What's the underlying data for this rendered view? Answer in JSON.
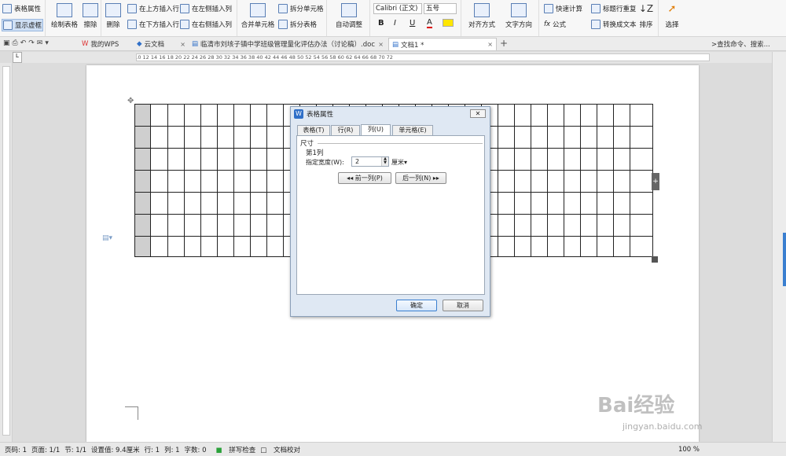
{
  "ribbon": {
    "table_props": "表格属性",
    "show_gridlines": "显示虚框",
    "draw_table": "绘制表格",
    "erase": "擦除",
    "delete": "删除",
    "insert_row_above": "在上方插入行",
    "insert_row_below": "在下方插入行",
    "insert_col_left": "在左侧插入列",
    "insert_col_right": "在右侧插入列",
    "merge_cells": "合并单元格",
    "split_cells": "拆分单元格",
    "split_table": "拆分表格",
    "auto_fit": "自动调整",
    "font_name": "Calibri (正文)",
    "font_size": "五号",
    "bold": "B",
    "italic": "I",
    "underline": "U",
    "font_color": "A",
    "align": "对齐方式",
    "text_direction": "文字方向",
    "quick_calc": "快速计算",
    "formula": "公式",
    "repeat_header": "标题行重复",
    "to_text": "转换成文本",
    "sort": "排序",
    "select": "选择"
  },
  "quickbar": {
    "search": ">查找命令、搜索..."
  },
  "tabs": [
    {
      "label": "我的WPS"
    },
    {
      "label": "云文档"
    },
    {
      "label": "临清市刘垓子镇中学班级管理量化评估办法（讨论稿）.doc"
    },
    {
      "label": "文档1 *"
    }
  ],
  "ruler_marks": "4  2     2  4  6  8  10  12  14  16  18  20  22  24  26  28  30  32  34  36  38  40  42  44  46  48  50  52  54  56  58  60  62  64  66  68  70  72",
  "dialog": {
    "title": "表格属性",
    "tabs": [
      "表格(T)",
      "行(R)",
      "列(U)",
      "单元格(E)"
    ],
    "section": "尺寸",
    "column_label": "第1列",
    "width_label": "指定宽度(W):",
    "width_value": "2",
    "unit": "厘米",
    "prev_col": "◂◂ 前一列(P)",
    "next_col": "后一列(N) ▸▸",
    "ok": "确定",
    "cancel": "取消"
  },
  "status": {
    "page": "页码: 1",
    "pages": "页面: 1/1",
    "section": "节: 1/1",
    "setting": "设置值: 9.4厘米",
    "row": "行: 1",
    "col": "列: 1",
    "words": "字数: 0",
    "spell": "拼写检查",
    "proof": "文档校对",
    "zoom": "100 %"
  },
  "watermark": {
    "text": "Bai经验",
    "url": "jingyan.baidu.com"
  },
  "colors": {
    "accent": "#3a7fd0",
    "table_shade": "#cfcfcf",
    "dialog_bg": "#dfe8f3"
  }
}
